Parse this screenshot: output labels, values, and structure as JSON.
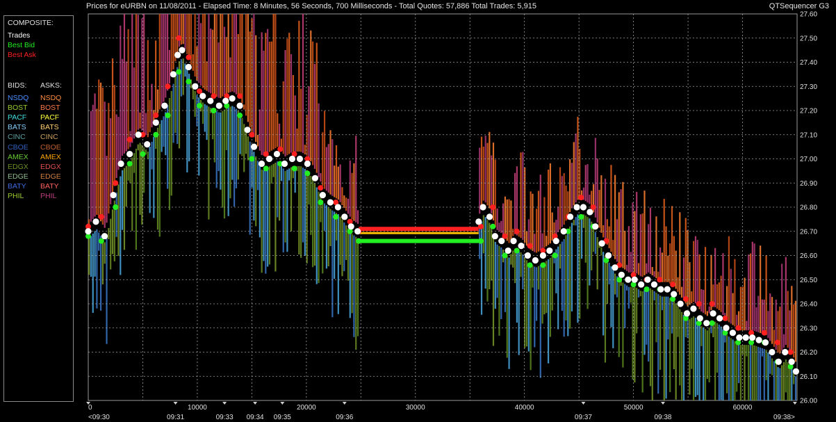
{
  "header": {
    "title": "Prices for  eURBN  on  11/08/2011  -  Elapsed Time: 8 Minutes, 56 Seconds, 700 Milliseconds  -  Total Quotes: 57,886  Total Trades: 5,915",
    "app_name": "QTSequencer G3"
  },
  "legend": {
    "composite_label": "COMPOSITE:",
    "composite_items": [
      {
        "label": "Trades",
        "color": "#ffffff"
      },
      {
        "label": "Best Bid",
        "color": "#22ee22"
      },
      {
        "label": "Best Ask",
        "color": "#ff2020"
      }
    ],
    "bids_label": "BIDS:",
    "asks_label": "ASKS:",
    "exchanges": [
      {
        "bid": "NSDQ",
        "ask": "NSDQ",
        "bid_color": "#4a8cff",
        "ask_color": "#ff8c40"
      },
      {
        "bid": "BOST",
        "ask": "BOST",
        "bid_color": "#9acd32",
        "ask_color": "#ff7a4a"
      },
      {
        "bid": "PACF",
        "ask": "PACF",
        "bid_color": "#40e0e0",
        "ask_color": "#ffff40"
      },
      {
        "bid": "BATS",
        "ask": "BATS",
        "bid_color": "#87cefa",
        "ask_color": "#ffd070"
      },
      {
        "bid": "CINC",
        "ask": "CINC",
        "bid_color": "#5f9ea0",
        "ask_color": "#c8a060"
      },
      {
        "bid": "CBOE",
        "ask": "CBOE",
        "bid_color": "#3060c0",
        "ask_color": "#c06030"
      },
      {
        "bid": "AMEX",
        "ask": "AMEX",
        "bid_color": "#66cc33",
        "ask_color": "#ffa500"
      },
      {
        "bid": "EDGX",
        "ask": "EDGX",
        "bid_color": "#6b8e23",
        "ask_color": "#e05050"
      },
      {
        "bid": "EDGE",
        "ask": "EDGE",
        "bid_color": "#8fbc8f",
        "ask_color": "#d08040"
      },
      {
        "bid": "BATY",
        "ask": "BATY",
        "bid_color": "#4169e1",
        "ask_color": "#ff6060"
      },
      {
        "bid": "PHIL",
        "ask": "PHIL",
        "bid_color": "#9acd32",
        "ask_color": "#c04080"
      }
    ]
  },
  "chart_data": {
    "type": "scatter",
    "title": "",
    "xlabel": "",
    "ylabel": "",
    "xlim": [
      0,
      65000
    ],
    "ylim": [
      26.0,
      27.6
    ],
    "grid": true,
    "y_ticks": [
      "27.60",
      "27.50",
      "27.40",
      "27.30",
      "27.20",
      "27.10",
      "27.00",
      "26.90",
      "26.80",
      "26.70",
      "26.60",
      "26.50",
      "26.40",
      "26.30",
      "26.20",
      "26.10",
      "26.00"
    ],
    "x_ticks": [
      {
        "x": 0,
        "label": "0"
      },
      {
        "x": 10000,
        "label": "10000"
      },
      {
        "x": 20000,
        "label": "20000"
      },
      {
        "x": 30000,
        "label": "30000"
      },
      {
        "x": 40000,
        "label": "40000"
      },
      {
        "x": 50000,
        "label": "50000"
      },
      {
        "x": 60000,
        "label": "60000"
      }
    ],
    "time_labels": [
      {
        "x": 0,
        "label": "<09:30"
      },
      {
        "x": 8000,
        "label": "09:31"
      },
      {
        "x": 12500,
        "label": "09:33"
      },
      {
        "x": 15300,
        "label": "09:34"
      },
      {
        "x": 17800,
        "label": "09:35"
      },
      {
        "x": 23500,
        "label": "09:36"
      },
      {
        "x": 45400,
        "label": "09:37"
      },
      {
        "x": 52700,
        "label": "09:38"
      },
      {
        "x": 64800,
        "label": "09:38>"
      }
    ],
    "series": [
      {
        "name": "Trades",
        "color": "#ffffff",
        "points": [
          [
            0,
            26.7
          ],
          [
            700,
            26.74
          ],
          [
            1500,
            26.68
          ],
          [
            2300,
            26.85
          ],
          [
            3000,
            26.98
          ],
          [
            3800,
            27.02
          ],
          [
            4600,
            27.1
          ],
          [
            5400,
            27.06
          ],
          [
            6200,
            27.15
          ],
          [
            7000,
            27.22
          ],
          [
            7800,
            27.35
          ],
          [
            8200,
            27.43
          ],
          [
            8600,
            27.45
          ],
          [
            9200,
            27.38
          ],
          [
            9800,
            27.3
          ],
          [
            10500,
            27.26
          ],
          [
            11200,
            27.24
          ],
          [
            12000,
            27.22
          ],
          [
            12600,
            27.24
          ],
          [
            13200,
            27.25
          ],
          [
            13900,
            27.22
          ],
          [
            14600,
            27.12
          ],
          [
            15200,
            27.05
          ],
          [
            15900,
            26.98
          ],
          [
            16600,
            27.0
          ],
          [
            17300,
            27.02
          ],
          [
            18000,
            26.98
          ],
          [
            18700,
            27.0
          ],
          [
            19400,
            27.0
          ],
          [
            20100,
            26.98
          ],
          [
            20800,
            26.92
          ],
          [
            21500,
            26.85
          ],
          [
            22200,
            26.82
          ],
          [
            22900,
            26.8
          ],
          [
            23500,
            26.76
          ],
          [
            24100,
            26.72
          ],
          [
            24700,
            26.7
          ],
          [
            35800,
            26.74
          ],
          [
            36200,
            26.8
          ],
          [
            36800,
            26.76
          ],
          [
            37300,
            26.68
          ],
          [
            37900,
            26.66
          ],
          [
            38500,
            26.62
          ],
          [
            39000,
            26.66
          ],
          [
            39700,
            26.64
          ],
          [
            40300,
            26.6
          ],
          [
            41000,
            26.58
          ],
          [
            41700,
            26.6
          ],
          [
            42300,
            26.62
          ],
          [
            42900,
            26.66
          ],
          [
            43600,
            26.7
          ],
          [
            44200,
            26.76
          ],
          [
            44800,
            26.8
          ],
          [
            45400,
            26.8
          ],
          [
            46000,
            26.78
          ],
          [
            46500,
            26.72
          ],
          [
            47100,
            26.65
          ],
          [
            47700,
            26.6
          ],
          [
            48300,
            26.55
          ],
          [
            48900,
            26.52
          ],
          [
            49500,
            26.5
          ],
          [
            50100,
            26.5
          ],
          [
            50700,
            26.48
          ],
          [
            51300,
            26.5
          ],
          [
            51900,
            26.48
          ],
          [
            52500,
            26.46
          ],
          [
            53100,
            26.46
          ],
          [
            53700,
            26.44
          ],
          [
            54300,
            26.4
          ],
          [
            54900,
            26.36
          ],
          [
            55500,
            26.38
          ],
          [
            56100,
            26.34
          ],
          [
            56700,
            26.32
          ],
          [
            57300,
            26.36
          ],
          [
            57900,
            26.34
          ],
          [
            58500,
            26.3
          ],
          [
            59100,
            26.28
          ],
          [
            59700,
            26.26
          ],
          [
            60300,
            26.26
          ],
          [
            60900,
            26.26
          ],
          [
            61500,
            26.25
          ],
          [
            62100,
            26.24
          ],
          [
            62700,
            26.2
          ],
          [
            63300,
            26.16
          ],
          [
            63900,
            26.2
          ],
          [
            64500,
            26.16
          ],
          [
            64900,
            26.12
          ]
        ]
      },
      {
        "name": "Best Bid",
        "color": "#22ee22",
        "points": [
          [
            0,
            26.68
          ],
          [
            1200,
            26.66
          ],
          [
            2500,
            26.8
          ],
          [
            3800,
            26.98
          ],
          [
            5000,
            27.02
          ],
          [
            6200,
            27.1
          ],
          [
            7300,
            27.18
          ],
          [
            8300,
            27.36
          ],
          [
            9200,
            27.32
          ],
          [
            10200,
            27.22
          ],
          [
            11500,
            27.2
          ],
          [
            12700,
            27.22
          ],
          [
            13900,
            27.18
          ],
          [
            15000,
            27.0
          ],
          [
            16300,
            26.96
          ],
          [
            17600,
            26.98
          ],
          [
            18900,
            26.96
          ],
          [
            20100,
            26.94
          ],
          [
            21300,
            26.82
          ],
          [
            22700,
            26.76
          ],
          [
            24000,
            26.7
          ],
          [
            24800,
            26.66
          ],
          [
            36000,
            26.66
          ],
          [
            37100,
            26.72
          ],
          [
            38200,
            26.6
          ],
          [
            39300,
            26.62
          ],
          [
            40500,
            26.56
          ],
          [
            41700,
            26.56
          ],
          [
            42800,
            26.6
          ],
          [
            44000,
            26.7
          ],
          [
            45200,
            26.76
          ],
          [
            46300,
            26.72
          ],
          [
            47500,
            26.58
          ],
          [
            48700,
            26.5
          ],
          [
            50000,
            26.48
          ],
          [
            51200,
            26.46
          ],
          [
            52400,
            26.46
          ],
          [
            53600,
            26.42
          ],
          [
            54800,
            26.34
          ],
          [
            56000,
            26.32
          ],
          [
            57200,
            26.32
          ],
          [
            58400,
            26.28
          ],
          [
            59600,
            26.24
          ],
          [
            60800,
            26.24
          ],
          [
            62000,
            26.24
          ],
          [
            63200,
            26.16
          ],
          [
            64400,
            26.14
          ]
        ]
      },
      {
        "name": "Best Ask",
        "color": "#ff2020",
        "points": [
          [
            0,
            26.72
          ],
          [
            1200,
            26.76
          ],
          [
            2500,
            26.9
          ],
          [
            3800,
            27.08
          ],
          [
            5000,
            27.1
          ],
          [
            6200,
            27.18
          ],
          [
            7300,
            27.3
          ],
          [
            8300,
            27.5
          ],
          [
            9200,
            27.42
          ],
          [
            10200,
            27.28
          ],
          [
            11500,
            27.26
          ],
          [
            12700,
            27.26
          ],
          [
            13900,
            27.26
          ],
          [
            15000,
            27.1
          ],
          [
            16300,
            27.02
          ],
          [
            17600,
            27.04
          ],
          [
            18900,
            27.02
          ],
          [
            20100,
            27.0
          ],
          [
            21300,
            26.88
          ],
          [
            22700,
            26.82
          ],
          [
            24000,
            26.74
          ],
          [
            24800,
            26.7
          ],
          [
            36000,
            26.72
          ],
          [
            37100,
            26.8
          ],
          [
            38200,
            26.68
          ],
          [
            39300,
            26.7
          ],
          [
            40500,
            26.64
          ],
          [
            41700,
            26.62
          ],
          [
            42800,
            26.68
          ],
          [
            44000,
            26.76
          ],
          [
            45200,
            26.84
          ],
          [
            46300,
            26.8
          ],
          [
            47500,
            26.66
          ],
          [
            48700,
            26.56
          ],
          [
            50000,
            26.52
          ],
          [
            51200,
            26.5
          ],
          [
            52400,
            26.5
          ],
          [
            53600,
            26.48
          ],
          [
            54800,
            26.42
          ],
          [
            56000,
            26.4
          ],
          [
            57200,
            26.4
          ],
          [
            58400,
            26.34
          ],
          [
            59600,
            26.3
          ],
          [
            60800,
            26.28
          ],
          [
            62000,
            26.28
          ],
          [
            63200,
            26.24
          ],
          [
            64400,
            26.2
          ]
        ]
      }
    ],
    "gap_segment": {
      "x_start": 24800,
      "x_end": 35800,
      "bid": 26.66,
      "ask": 26.71
    }
  }
}
